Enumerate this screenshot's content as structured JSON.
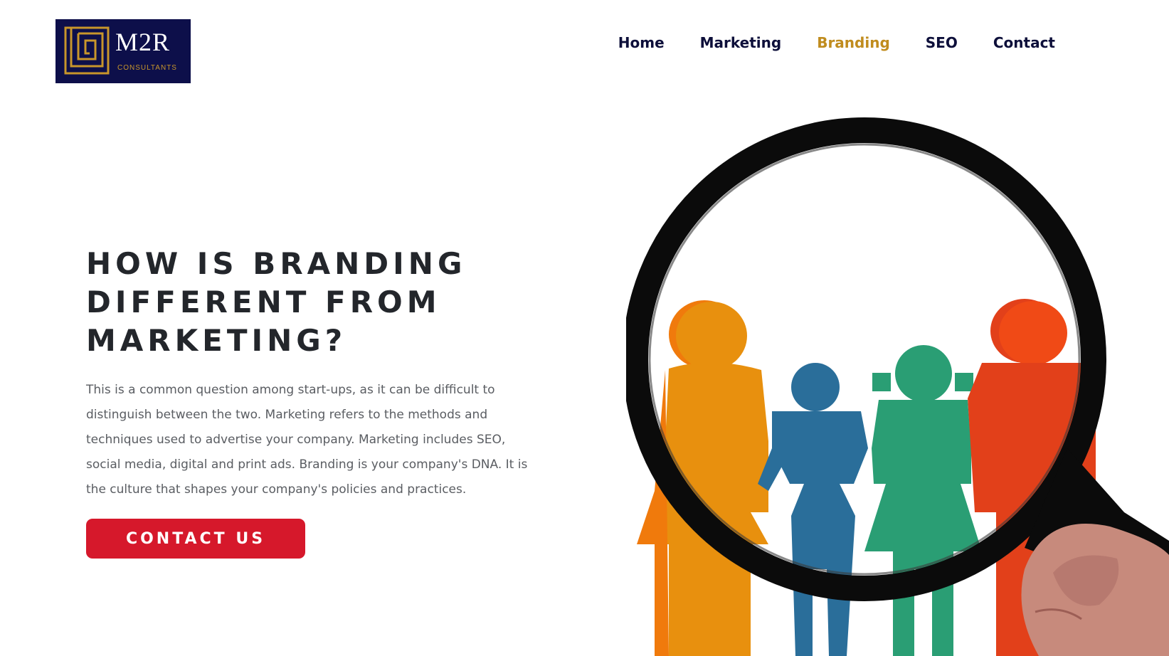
{
  "logo": {
    "wordmark": "M2R",
    "subtitle": "CONSULTANTS",
    "icon": "maze-logo-icon",
    "background_color": "#0d0f4a",
    "accent_color": "#c8962b"
  },
  "nav": {
    "items": [
      {
        "label": "Home",
        "active": false
      },
      {
        "label": "Marketing",
        "active": false
      },
      {
        "label": "Branding",
        "active": true
      },
      {
        "label": "SEO",
        "active": false
      },
      {
        "label": "Contact",
        "active": false
      }
    ],
    "text_color": "#0d0f3a",
    "active_color": "#c08c1e"
  },
  "hero": {
    "title": "HOW IS BRANDING DIFFERENT FROM MARKETING?",
    "body": "This is a common question among start-ups, as it can be difficult to distinguish between the two. Marketing refers to the methods and techniques used to advertise your company. Marketing includes SEO, social media, digital and print ads. Branding is your company's DNA. It is the culture that shapes your company's policies and practices.",
    "cta_label": "CONTACT US",
    "cta_color": "#d6182b"
  },
  "illustration": {
    "icon": "magnifying-glass-people-illustration",
    "figure_colors": [
      "#e8900e",
      "#2a6e9a",
      "#2a9e74",
      "#e2401a"
    ]
  }
}
